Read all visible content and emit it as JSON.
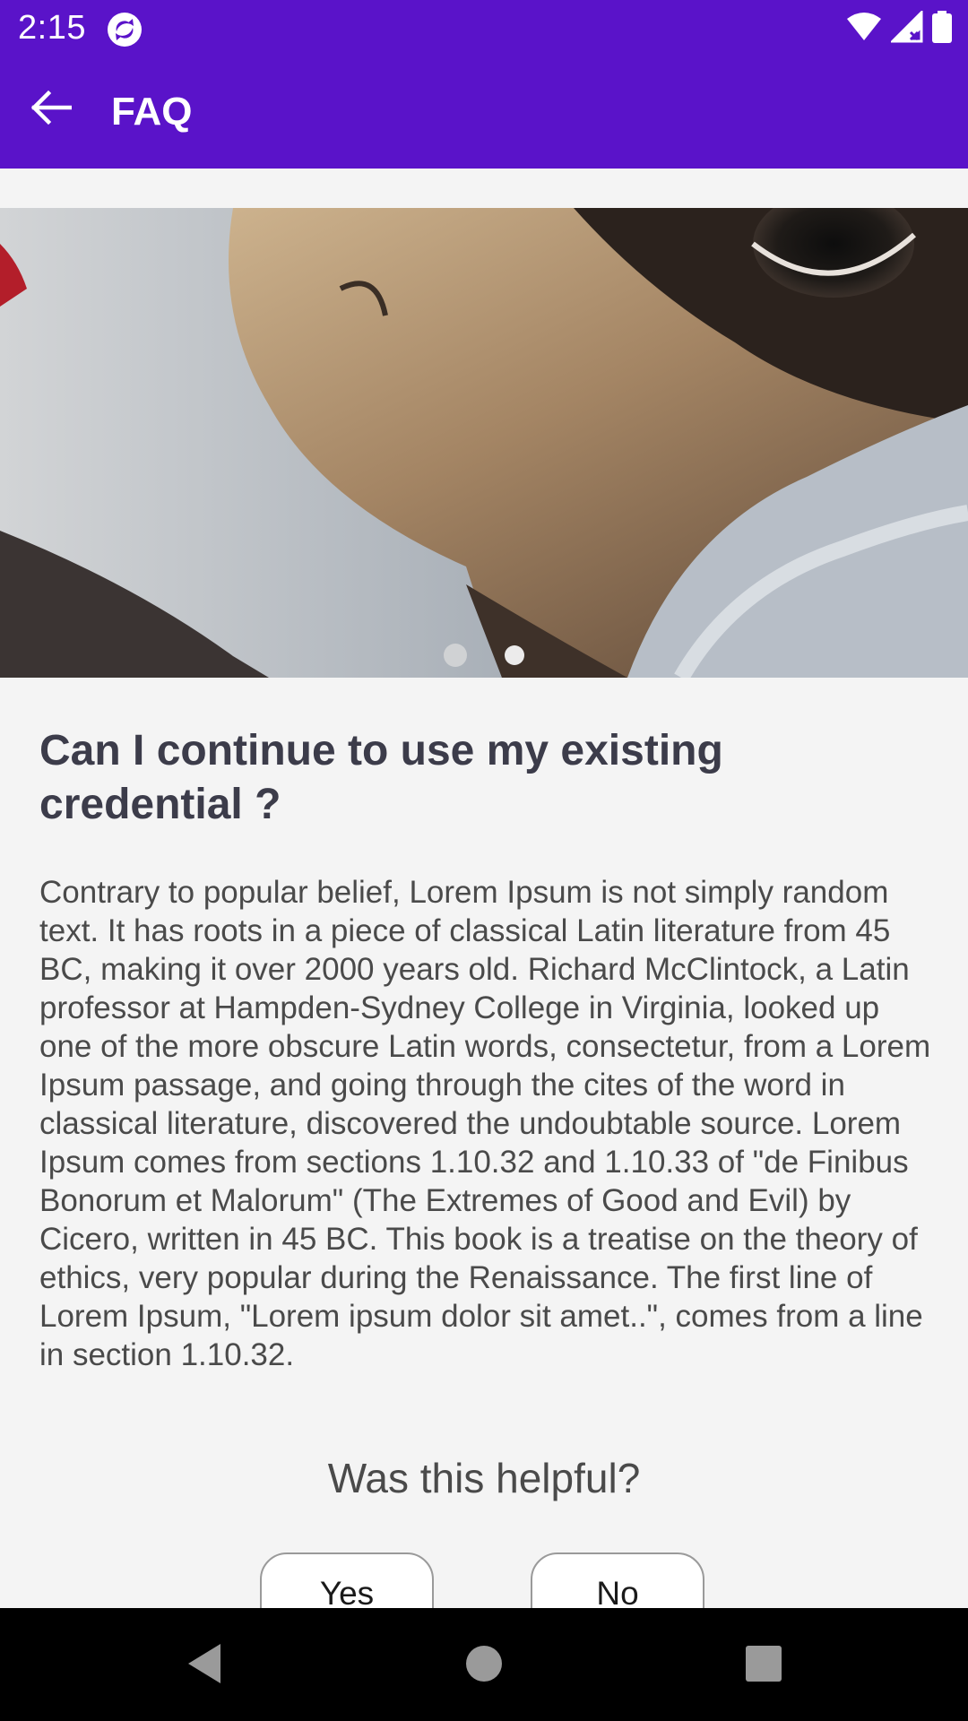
{
  "status_bar": {
    "time": "2:15",
    "icons": [
      "sync-app-icon",
      "wifi-icon",
      "cell-signal-icon",
      "battery-icon"
    ]
  },
  "app_bar": {
    "title": "FAQ",
    "back_icon": "arrow-left-icon",
    "color": "#5a13c9"
  },
  "carousel": {
    "page_count": 2,
    "current_page": 2
  },
  "faq": {
    "question": "Can I continue to use my existing credential ?",
    "answer": "Contrary to popular belief, Lorem Ipsum is not simply random text. It has roots in a piece of classical Latin literature from 45 BC, making it over 2000 years old. Richard McClintock, a Latin professor at Hampden-Sydney College in Virginia, looked up one of the more obscure Latin words, consectetur, from a Lorem Ipsum passage, and going through the cites of the word in classical literature, discovered the undoubtable source. Lorem Ipsum comes from sections 1.10.32 and 1.10.33 of \"de Finibus Bonorum et Malorum\" (The Extremes of Good and Evil) by Cicero, written in 45 BC. This book is a treatise on the theory of ethics, very popular during the Renaissance. The first line of Lorem Ipsum, \"Lorem ipsum dolor sit amet..\", comes from a line in section 1.10.32."
  },
  "feedback": {
    "prompt": "Was this helpful?",
    "yes_label": "Yes",
    "no_label": "No"
  },
  "nav_bar": {
    "icons": [
      "back-triangle-icon",
      "home-circle-icon",
      "recents-square-icon"
    ]
  }
}
